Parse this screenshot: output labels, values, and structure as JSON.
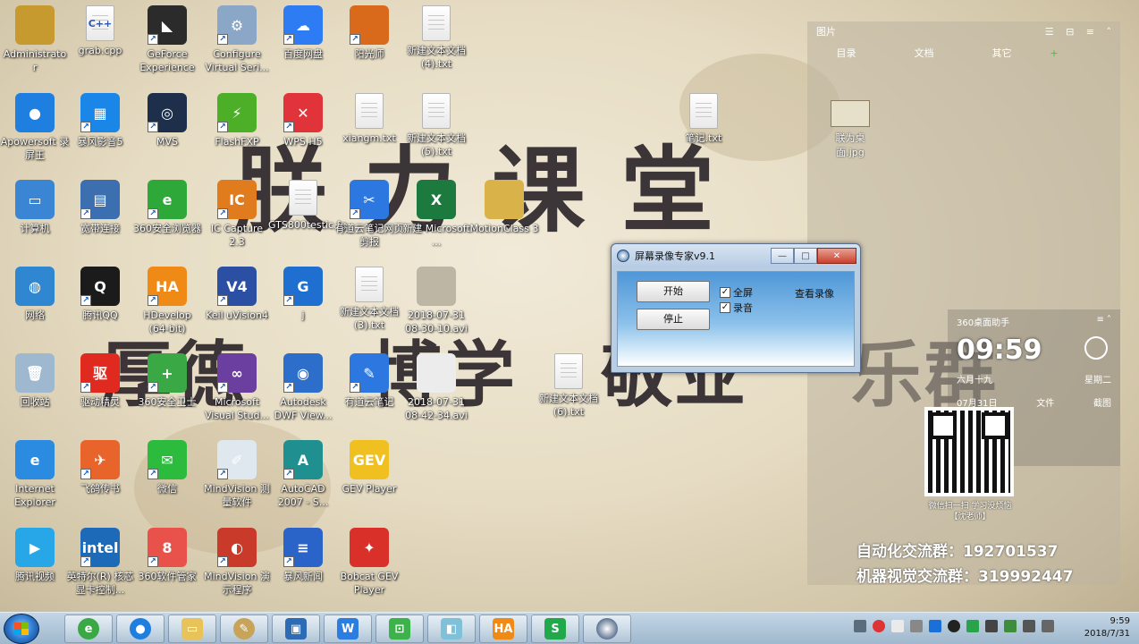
{
  "wallpaper": {
    "title_line": "朕 力 课 堂",
    "motto_1": "厚德",
    "motto_2": "博学",
    "motto_3": "敬业",
    "motto_4": "乐群",
    "group_1": "自动化交流群：192701537",
    "group_2": "机器视觉交流群：319992447",
    "qr_caption_1": "微信扫一扫 学习没烦恼",
    "qr_caption_2": "【沈老师】"
  },
  "desktop_icons": [
    {
      "label": "Administrato r",
      "color": "#c69a2e",
      "glyph": "",
      "kind": "app",
      "shortcut": false
    },
    {
      "label": "grab.cpp",
      "color": "#ffffff",
      "glyph": "C++",
      "kind": "doc",
      "shortcut": false
    },
    {
      "label": "GeForce Experience",
      "color": "#2b2b2b",
      "glyph": "◣",
      "kind": "app",
      "shortcut": true
    },
    {
      "label": "Configure Virtual Seri...",
      "color": "#8aa7c7",
      "glyph": "⚙",
      "kind": "app",
      "shortcut": true
    },
    {
      "label": "百度网盘",
      "color": "#2d7cf4",
      "glyph": "☁",
      "kind": "app",
      "shortcut": true
    },
    {
      "label": "阳光师",
      "color": "#d96a1b",
      "glyph": "",
      "kind": "app",
      "shortcut": true
    },
    {
      "label": "新建文本文档 (4).txt",
      "color": "#ffffff",
      "glyph": "",
      "kind": "doc",
      "shortcut": false
    },
    {
      "label": "Apowersoft 录屏王",
      "color": "#1e7fe0",
      "glyph": "●",
      "kind": "app",
      "shortcut": false
    },
    {
      "label": "暴风影音5",
      "color": "#1a86e8",
      "glyph": "▦",
      "kind": "app",
      "shortcut": true
    },
    {
      "label": "MVS",
      "color": "#1d2f4a",
      "glyph": "◎",
      "kind": "app",
      "shortcut": true
    },
    {
      "label": "FlashFXP",
      "color": "#4caf27",
      "glyph": "⚡",
      "kind": "app",
      "shortcut": true
    },
    {
      "label": "WPS H5",
      "color": "#e0333a",
      "glyph": "✕",
      "kind": "app",
      "shortcut": true
    },
    {
      "label": "xiangm.txt",
      "color": "#ffffff",
      "glyph": "",
      "kind": "doc",
      "shortcut": false
    },
    {
      "label": "新建文本文档 (5).txt",
      "color": "#ffffff",
      "glyph": "",
      "kind": "doc",
      "shortcut": false
    },
    {
      "label": "计算机",
      "color": "#3a86d4",
      "glyph": "▭",
      "kind": "app",
      "shortcut": false
    },
    {
      "label": "宽带连接",
      "color": "#3b6fb0",
      "glyph": "▤",
      "kind": "app",
      "shortcut": true
    },
    {
      "label": "360安全浏览器",
      "color": "#2fa83a",
      "glyph": "e",
      "kind": "app",
      "shortcut": true
    },
    {
      "label": "IC Capture 2.3",
      "color": "#e07b1e",
      "glyph": "IC",
      "kind": "app",
      "shortcut": true
    },
    {
      "label": "GTS800testic.fg",
      "color": "#e8e8e8",
      "glyph": "",
      "kind": "doc",
      "shortcut": false
    },
    {
      "label": "有道云笔记网页剪报",
      "color": "#2c78e0",
      "glyph": "✂",
      "kind": "app",
      "shortcut": true
    },
    {
      "label": "新建 Microsoft ...",
      "color": "#1d7a3e",
      "glyph": "X",
      "kind": "app",
      "shortcut": false
    },
    {
      "label": "MotionClass 3",
      "color": "#d9b34a",
      "glyph": "",
      "kind": "app",
      "shortcut": false
    },
    {
      "label": "网络",
      "color": "#2f87d1",
      "glyph": "◍",
      "kind": "app",
      "shortcut": false
    },
    {
      "label": "腾讯QQ",
      "color": "#1b1b1b",
      "glyph": "Q",
      "kind": "app",
      "shortcut": true
    },
    {
      "label": "HDevelop (64-bit)",
      "color": "#f08a16",
      "glyph": "HA",
      "kind": "app",
      "shortcut": true
    },
    {
      "label": "Keil uVision4",
      "color": "#2a4fa3",
      "glyph": "V4",
      "kind": "app",
      "shortcut": true
    },
    {
      "label": "j",
      "color": "#1f6fd1",
      "glyph": "G",
      "kind": "app",
      "shortcut": true
    },
    {
      "label": "新建文本文档 (3).txt",
      "color": "#ffffff",
      "glyph": "",
      "kind": "doc",
      "shortcut": false
    },
    {
      "label": "2018-07-31 08-30-10.avi",
      "color": "#bdb6a4",
      "glyph": "",
      "kind": "app",
      "shortcut": false
    },
    {
      "label": "回收站",
      "color": "#9db8cf",
      "glyph": "🗑",
      "kind": "app",
      "shortcut": false
    },
    {
      "label": "驱动精灵",
      "color": "#e02a1f",
      "glyph": "驱",
      "kind": "app",
      "shortcut": true
    },
    {
      "label": "360安全卫士",
      "color": "#39a845",
      "glyph": "+",
      "kind": "app",
      "shortcut": true
    },
    {
      "label": "Microsoft Visual Stud...",
      "color": "#6b3fa0",
      "glyph": "∞",
      "kind": "app",
      "shortcut": true
    },
    {
      "label": "Autodesk DWF View...",
      "color": "#2c6ec9",
      "glyph": "◉",
      "kind": "app",
      "shortcut": true
    },
    {
      "label": "有道云笔记",
      "color": "#2c78e0",
      "glyph": "✎",
      "kind": "app",
      "shortcut": true
    },
    {
      "label": "2018-07-31 08-42-34.avi",
      "color": "#ececec",
      "glyph": "",
      "kind": "app",
      "shortcut": false
    },
    {
      "label": "Internet Explorer",
      "color": "#2b8be0",
      "glyph": "e",
      "kind": "app",
      "shortcut": false
    },
    {
      "label": "飞鸽传书",
      "color": "#e8642a",
      "glyph": "✈",
      "kind": "app",
      "shortcut": true
    },
    {
      "label": "微信",
      "color": "#2dbb3d",
      "glyph": "✉",
      "kind": "app",
      "shortcut": true
    },
    {
      "label": "MindVision 测量软件",
      "color": "#dfe7ef",
      "glyph": "✐",
      "kind": "app",
      "shortcut": true
    },
    {
      "label": "AutoCAD 2007 - S...",
      "color": "#1f8f8f",
      "glyph": "A",
      "kind": "app",
      "shortcut": true
    },
    {
      "label": "GEV Player",
      "color": "#f0c020",
      "glyph": "GEV",
      "kind": "app",
      "shortcut": false
    },
    {
      "label": "腾讯视频",
      "color": "#27a6e8",
      "glyph": "▶",
      "kind": "app",
      "shortcut": false
    },
    {
      "label": "英特尔(R) 核芯显卡控制...",
      "color": "#1c6ab8",
      "glyph": "intel",
      "kind": "app",
      "shortcut": true
    },
    {
      "label": "360软件管家",
      "color": "#e8524a",
      "glyph": "8",
      "kind": "app",
      "shortcut": true
    },
    {
      "label": "MindVision 演示程序",
      "color": "#c93a2b",
      "glyph": "◐",
      "kind": "app",
      "shortcut": true
    },
    {
      "label": "暴风新闻",
      "color": "#2a64c9",
      "glyph": "≡",
      "kind": "app",
      "shortcut": true
    },
    {
      "label": "Bobcat GEV Player",
      "color": "#d9302a",
      "glyph": "✦",
      "kind": "app",
      "shortcut": false
    },
    {
      "label": "新建文本文档 (6).txt",
      "color": "#ffffff",
      "glyph": "",
      "kind": "doc",
      "shortcut": false
    },
    {
      "label": "笔记.txt",
      "color": "#ffffff",
      "glyph": "",
      "kind": "doc",
      "shortcut": false
    }
  ],
  "side_panel": {
    "title": "图片",
    "tabs": [
      "目录",
      "文档",
      "其它"
    ],
    "add_label": "+",
    "file_label": "联为桌面.jpg"
  },
  "assistant": {
    "title": "360桌面助手",
    "time": "09:59",
    "lunar": "六月十九",
    "date": "07月31日",
    "weekday": "星期二",
    "row_file": "文件",
    "row_screenshot": "截图"
  },
  "window": {
    "title": "屏幕录像专家v9.1",
    "start_label": "开始",
    "stop_label": "停止",
    "fullscreen_label": "全屏",
    "audio_label": "录音",
    "view_label": "查看录像",
    "fullscreen_checked": true,
    "audio_checked": true
  },
  "taskbar": {
    "time": "9:59",
    "date": "2018/7/31"
  }
}
